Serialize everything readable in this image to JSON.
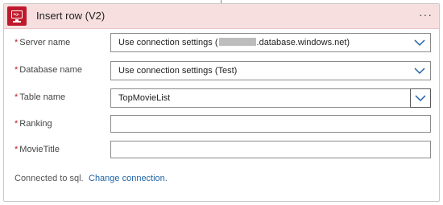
{
  "header": {
    "icon": "sql-server-icon",
    "icon_text": "SQL",
    "title": "Insert row (V2)",
    "more_label": "···"
  },
  "colors": {
    "header_bg": "#f7dfe0",
    "icon_bg": "#c0182b",
    "required": "#c0182b",
    "link": "#2064a8",
    "chevron": "#2064a8"
  },
  "fields": [
    {
      "label": "Server name",
      "required": "*",
      "value_prefix": "Use connection settings (",
      "value_suffix": ".database.windows.net)",
      "type": "dropdown"
    },
    {
      "label": "Database name",
      "required": "*",
      "value": "Use connection settings (Test)",
      "type": "dropdown"
    },
    {
      "label": "Table name",
      "required": "*",
      "value": "TopMovieList",
      "type": "dropdown"
    },
    {
      "label": "Ranking",
      "required": "*",
      "value": "",
      "type": "text"
    },
    {
      "label": "MovieTitle",
      "required": "*",
      "value": "",
      "type": "text"
    }
  ],
  "footer": {
    "connected_text": "Connected to sql.",
    "change_link": "Change connection."
  }
}
